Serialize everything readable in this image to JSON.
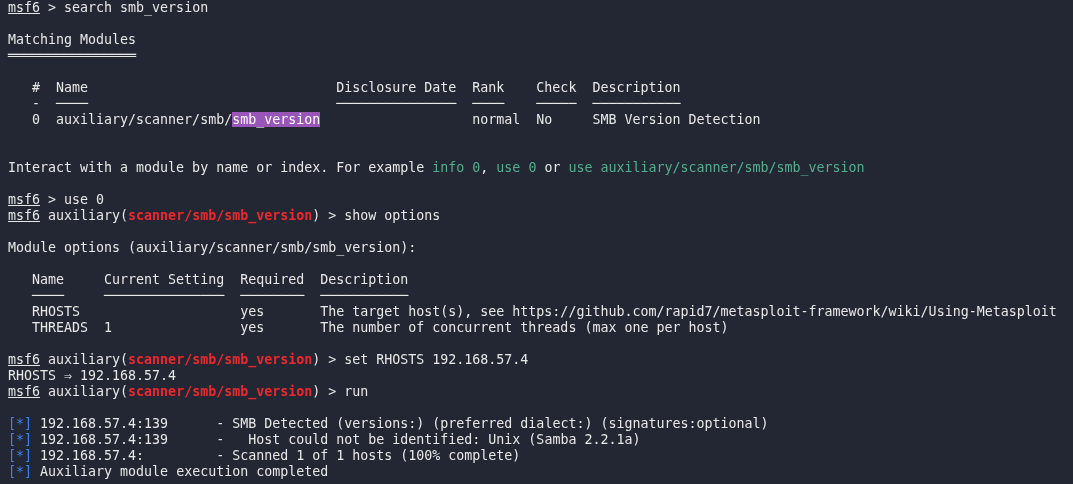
{
  "lines": [
    {
      "kind": "text",
      "segments": [
        {
          "kind": "prompt",
          "text": "msf6"
        },
        {
          "kind": "plain",
          "text": " > search smb_version"
        }
      ]
    },
    {
      "kind": "blank"
    },
    {
      "kind": "text",
      "segments": [
        {
          "kind": "plain",
          "text": "Matching Modules"
        }
      ]
    },
    {
      "kind": "text",
      "segments": [
        {
          "kind": "plain",
          "text": "════════════════"
        }
      ]
    },
    {
      "kind": "blank"
    },
    {
      "kind": "text",
      "segments": [
        {
          "kind": "plain",
          "text": "   #  Name                               Disclosure Date  Rank    Check  Description"
        }
      ]
    },
    {
      "kind": "text",
      "segments": [
        {
          "kind": "plain",
          "text": "   -  ────                               ───────────────  ────    ─────  ───────────"
        }
      ]
    },
    {
      "kind": "text",
      "segments": [
        {
          "kind": "plain",
          "text": "   0  auxiliary/scanner/smb/"
        },
        {
          "kind": "match",
          "text": "smb_version"
        },
        {
          "kind": "plain",
          "text": "                   normal  No     SMB Version Detection"
        }
      ]
    },
    {
      "kind": "blank"
    },
    {
      "kind": "blank"
    },
    {
      "kind": "text",
      "segments": [
        {
          "kind": "plain",
          "text": "Interact with a module by name or index. For example "
        },
        {
          "kind": "suggestion",
          "text": "info 0"
        },
        {
          "kind": "plain",
          "text": ", "
        },
        {
          "kind": "suggestion",
          "text": "use 0"
        },
        {
          "kind": "plain",
          "text": " or "
        },
        {
          "kind": "suggestion",
          "text": "use auxiliary/scanner/smb/smb_version"
        }
      ]
    },
    {
      "kind": "blank"
    },
    {
      "kind": "text",
      "segments": [
        {
          "kind": "prompt",
          "text": "msf6"
        },
        {
          "kind": "plain",
          "text": " > use 0"
        }
      ]
    },
    {
      "kind": "text",
      "segments": [
        {
          "kind": "prompt",
          "text": "msf6"
        },
        {
          "kind": "plain",
          "text": " auxiliary("
        },
        {
          "kind": "module",
          "text": "scanner/smb/smb_version"
        },
        {
          "kind": "plain",
          "text": ") > show options"
        }
      ]
    },
    {
      "kind": "blank"
    },
    {
      "kind": "text",
      "segments": [
        {
          "kind": "plain",
          "text": "Module options (auxiliary/scanner/smb/smb_version):"
        }
      ]
    },
    {
      "kind": "blank"
    },
    {
      "kind": "text",
      "segments": [
        {
          "kind": "plain",
          "text": "   Name     Current Setting  Required  Description"
        }
      ]
    },
    {
      "kind": "text",
      "segments": [
        {
          "kind": "plain",
          "text": "   ────     ───────────────  ────────  ───────────"
        }
      ]
    },
    {
      "kind": "text",
      "segments": [
        {
          "kind": "plain",
          "text": "   RHOSTS                    yes       The target host(s), see https://github.com/rapid7/metasploit-framework/wiki/Using-Metasploit"
        }
      ]
    },
    {
      "kind": "text",
      "segments": [
        {
          "kind": "plain",
          "text": "   THREADS  1                yes       The number of concurrent threads (max one per host)"
        }
      ]
    },
    {
      "kind": "blank"
    },
    {
      "kind": "text",
      "segments": [
        {
          "kind": "prompt",
          "text": "msf6"
        },
        {
          "kind": "plain",
          "text": " auxiliary("
        },
        {
          "kind": "module",
          "text": "scanner/smb/smb_version"
        },
        {
          "kind": "plain",
          "text": ") > set RHOSTS 192.168.57.4"
        }
      ]
    },
    {
      "kind": "text",
      "segments": [
        {
          "kind": "plain",
          "text": "RHOSTS ⇒ 192.168.57.4"
        }
      ]
    },
    {
      "kind": "text",
      "segments": [
        {
          "kind": "prompt",
          "text": "msf6"
        },
        {
          "kind": "plain",
          "text": " auxiliary("
        },
        {
          "kind": "module",
          "text": "scanner/smb/smb_version"
        },
        {
          "kind": "plain",
          "text": ") > run"
        }
      ]
    },
    {
      "kind": "blank"
    },
    {
      "kind": "text",
      "segments": [
        {
          "kind": "status",
          "text": "[*]"
        },
        {
          "kind": "plain",
          "text": " 192.168.57.4:139      - SMB Detected (versions:) (preferred dialect:) (signatures:optional)"
        }
      ]
    },
    {
      "kind": "text",
      "segments": [
        {
          "kind": "status",
          "text": "[*]"
        },
        {
          "kind": "plain",
          "text": " 192.168.57.4:139      -   Host could not be identified: Unix (Samba 2.2.1a)"
        }
      ]
    },
    {
      "kind": "text",
      "segments": [
        {
          "kind": "status",
          "text": "[*]"
        },
        {
          "kind": "plain",
          "text": " 192.168.57.4:         - Scanned 1 of 1 hosts (100% complete)"
        }
      ]
    },
    {
      "kind": "text",
      "segments": [
        {
          "kind": "status",
          "text": "[*]"
        },
        {
          "kind": "plain",
          "text": " Auxiliary module execution completed"
        }
      ]
    }
  ]
}
